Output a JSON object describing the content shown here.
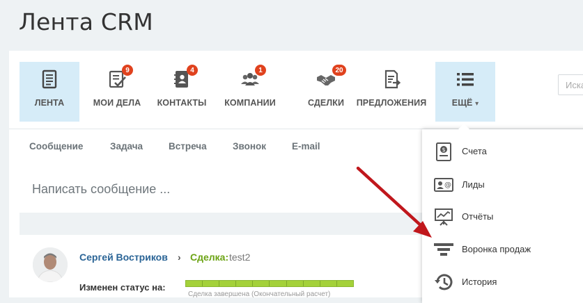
{
  "page": {
    "title": "Лента CRM"
  },
  "menu": {
    "items": [
      {
        "label": "ЛЕНТА",
        "icon": "feed-icon",
        "badge": ""
      },
      {
        "label": "МОИ ДЕЛА",
        "icon": "tasks-icon",
        "badge": "9"
      },
      {
        "label": "КОНТАКТЫ",
        "icon": "contacts-icon",
        "badge": "4"
      },
      {
        "label": "КОМПАНИИ",
        "icon": "companies-icon",
        "badge": "1"
      },
      {
        "label": "СДЕЛКИ",
        "icon": "deals-handshake-icon",
        "badge": "20"
      },
      {
        "label": "ПРЕДЛОЖЕНИЯ",
        "icon": "quotes-icon",
        "badge": ""
      },
      {
        "label": "ЕЩЁ",
        "icon": "more-list-icon",
        "badge": ""
      }
    ],
    "more_caret": "▾"
  },
  "search": {
    "placeholder": "Иска"
  },
  "composer": {
    "tabs": [
      "Сообщение",
      "Задача",
      "Встреча",
      "Звонок",
      "E-mail"
    ],
    "placeholder": "Написать сообщение ..."
  },
  "post": {
    "author": "Сергей Востриков",
    "separator": "›",
    "deal_label": "Сделка:",
    "deal_name": "test2",
    "status_label": "Изменен статус на:",
    "progress_fraction": 1.0,
    "progress_segments": 10,
    "progress_note": "Сделка завершена (Окончательный расчет)"
  },
  "dropdown": {
    "items": [
      {
        "label": "Счета",
        "icon": "invoice-icon"
      },
      {
        "label": "Лиды",
        "icon": "leads-icon"
      },
      {
        "label": "Отчёты",
        "icon": "reports-icon"
      },
      {
        "label": "Воронка продаж",
        "icon": "sales-funnel-icon"
      },
      {
        "label": "История",
        "icon": "history-icon"
      }
    ]
  },
  "colors": {
    "active_bg": "#d6ecf8",
    "badge": "#e0421e",
    "link": "#2a6496",
    "deal_green": "#6ba313",
    "progress_green": "#a4d13a",
    "annotation_arrow": "#c0171c"
  }
}
